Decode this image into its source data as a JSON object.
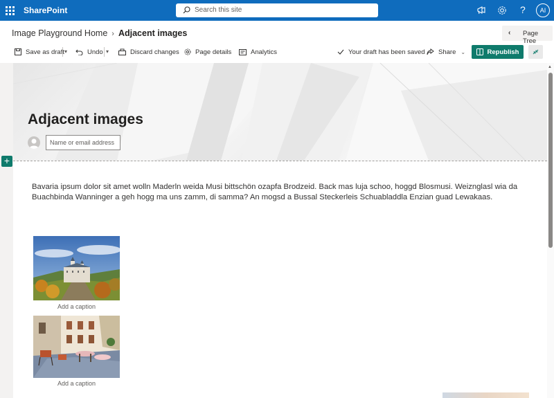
{
  "suite": {
    "app_name": "SharePoint",
    "search_placeholder": "Search this site",
    "avatar_initials": "AI",
    "help_label": "?"
  },
  "breadcrumb": {
    "parent": "Image Playground Home",
    "current": "Adjacent images",
    "page_tree_label": "Page Tree"
  },
  "commandbar": {
    "save_label": "Save as draft",
    "undo_label": "Undo",
    "discard_label": "Discard changes",
    "details_label": "Page details",
    "analytics_label": "Analytics",
    "status_text": "Your draft has been saved",
    "share_label": "Share",
    "republish_label": "Republish"
  },
  "page": {
    "title": "Adjacent images",
    "author_placeholder": "Name or email address",
    "body_text": "Bavaria ipsum dolor sit amet wolln Maderln weida Musi bittschön ozapfa Brodzeid. Back mas luja schoo, hoggd Blosmusi. Weiznglasl wia da Buachbinda Wanninger a geh hogg ma uns zamm, di samma? An mogsd a Bussal Steckerleis Schuabladdla Enzian guad Lewakaas.",
    "images": [
      {
        "caption": "Add a caption"
      },
      {
        "caption": "Add a caption"
      }
    ],
    "add_section_label": "+"
  },
  "colors": {
    "suite_blue": "#0f6cbd",
    "accent_teal": "#0f7b6c"
  }
}
